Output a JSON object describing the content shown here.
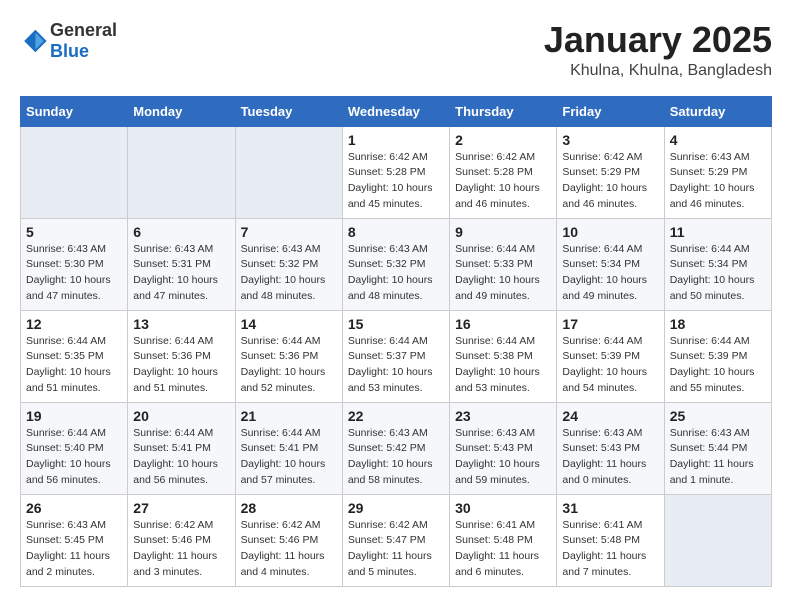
{
  "header": {
    "logo_general": "General",
    "logo_blue": "Blue",
    "month": "January 2025",
    "location": "Khulna, Khulna, Bangladesh"
  },
  "weekdays": [
    "Sunday",
    "Monday",
    "Tuesday",
    "Wednesday",
    "Thursday",
    "Friday",
    "Saturday"
  ],
  "weeks": [
    [
      {
        "day": "",
        "info": ""
      },
      {
        "day": "",
        "info": ""
      },
      {
        "day": "",
        "info": ""
      },
      {
        "day": "1",
        "info": "Sunrise: 6:42 AM\nSunset: 5:28 PM\nDaylight: 10 hours\nand 45 minutes."
      },
      {
        "day": "2",
        "info": "Sunrise: 6:42 AM\nSunset: 5:28 PM\nDaylight: 10 hours\nand 46 minutes."
      },
      {
        "day": "3",
        "info": "Sunrise: 6:42 AM\nSunset: 5:29 PM\nDaylight: 10 hours\nand 46 minutes."
      },
      {
        "day": "4",
        "info": "Sunrise: 6:43 AM\nSunset: 5:29 PM\nDaylight: 10 hours\nand 46 minutes."
      }
    ],
    [
      {
        "day": "5",
        "info": "Sunrise: 6:43 AM\nSunset: 5:30 PM\nDaylight: 10 hours\nand 47 minutes."
      },
      {
        "day": "6",
        "info": "Sunrise: 6:43 AM\nSunset: 5:31 PM\nDaylight: 10 hours\nand 47 minutes."
      },
      {
        "day": "7",
        "info": "Sunrise: 6:43 AM\nSunset: 5:32 PM\nDaylight: 10 hours\nand 48 minutes."
      },
      {
        "day": "8",
        "info": "Sunrise: 6:43 AM\nSunset: 5:32 PM\nDaylight: 10 hours\nand 48 minutes."
      },
      {
        "day": "9",
        "info": "Sunrise: 6:44 AM\nSunset: 5:33 PM\nDaylight: 10 hours\nand 49 minutes."
      },
      {
        "day": "10",
        "info": "Sunrise: 6:44 AM\nSunset: 5:34 PM\nDaylight: 10 hours\nand 49 minutes."
      },
      {
        "day": "11",
        "info": "Sunrise: 6:44 AM\nSunset: 5:34 PM\nDaylight: 10 hours\nand 50 minutes."
      }
    ],
    [
      {
        "day": "12",
        "info": "Sunrise: 6:44 AM\nSunset: 5:35 PM\nDaylight: 10 hours\nand 51 minutes."
      },
      {
        "day": "13",
        "info": "Sunrise: 6:44 AM\nSunset: 5:36 PM\nDaylight: 10 hours\nand 51 minutes."
      },
      {
        "day": "14",
        "info": "Sunrise: 6:44 AM\nSunset: 5:36 PM\nDaylight: 10 hours\nand 52 minutes."
      },
      {
        "day": "15",
        "info": "Sunrise: 6:44 AM\nSunset: 5:37 PM\nDaylight: 10 hours\nand 53 minutes."
      },
      {
        "day": "16",
        "info": "Sunrise: 6:44 AM\nSunset: 5:38 PM\nDaylight: 10 hours\nand 53 minutes."
      },
      {
        "day": "17",
        "info": "Sunrise: 6:44 AM\nSunset: 5:39 PM\nDaylight: 10 hours\nand 54 minutes."
      },
      {
        "day": "18",
        "info": "Sunrise: 6:44 AM\nSunset: 5:39 PM\nDaylight: 10 hours\nand 55 minutes."
      }
    ],
    [
      {
        "day": "19",
        "info": "Sunrise: 6:44 AM\nSunset: 5:40 PM\nDaylight: 10 hours\nand 56 minutes."
      },
      {
        "day": "20",
        "info": "Sunrise: 6:44 AM\nSunset: 5:41 PM\nDaylight: 10 hours\nand 56 minutes."
      },
      {
        "day": "21",
        "info": "Sunrise: 6:44 AM\nSunset: 5:41 PM\nDaylight: 10 hours\nand 57 minutes."
      },
      {
        "day": "22",
        "info": "Sunrise: 6:43 AM\nSunset: 5:42 PM\nDaylight: 10 hours\nand 58 minutes."
      },
      {
        "day": "23",
        "info": "Sunrise: 6:43 AM\nSunset: 5:43 PM\nDaylight: 10 hours\nand 59 minutes."
      },
      {
        "day": "24",
        "info": "Sunrise: 6:43 AM\nSunset: 5:43 PM\nDaylight: 11 hours\nand 0 minutes."
      },
      {
        "day": "25",
        "info": "Sunrise: 6:43 AM\nSunset: 5:44 PM\nDaylight: 11 hours\nand 1 minute."
      }
    ],
    [
      {
        "day": "26",
        "info": "Sunrise: 6:43 AM\nSunset: 5:45 PM\nDaylight: 11 hours\nand 2 minutes."
      },
      {
        "day": "27",
        "info": "Sunrise: 6:42 AM\nSunset: 5:46 PM\nDaylight: 11 hours\nand 3 minutes."
      },
      {
        "day": "28",
        "info": "Sunrise: 6:42 AM\nSunset: 5:46 PM\nDaylight: 11 hours\nand 4 minutes."
      },
      {
        "day": "29",
        "info": "Sunrise: 6:42 AM\nSunset: 5:47 PM\nDaylight: 11 hours\nand 5 minutes."
      },
      {
        "day": "30",
        "info": "Sunrise: 6:41 AM\nSunset: 5:48 PM\nDaylight: 11 hours\nand 6 minutes."
      },
      {
        "day": "31",
        "info": "Sunrise: 6:41 AM\nSunset: 5:48 PM\nDaylight: 11 hours\nand 7 minutes."
      },
      {
        "day": "",
        "info": ""
      }
    ]
  ]
}
